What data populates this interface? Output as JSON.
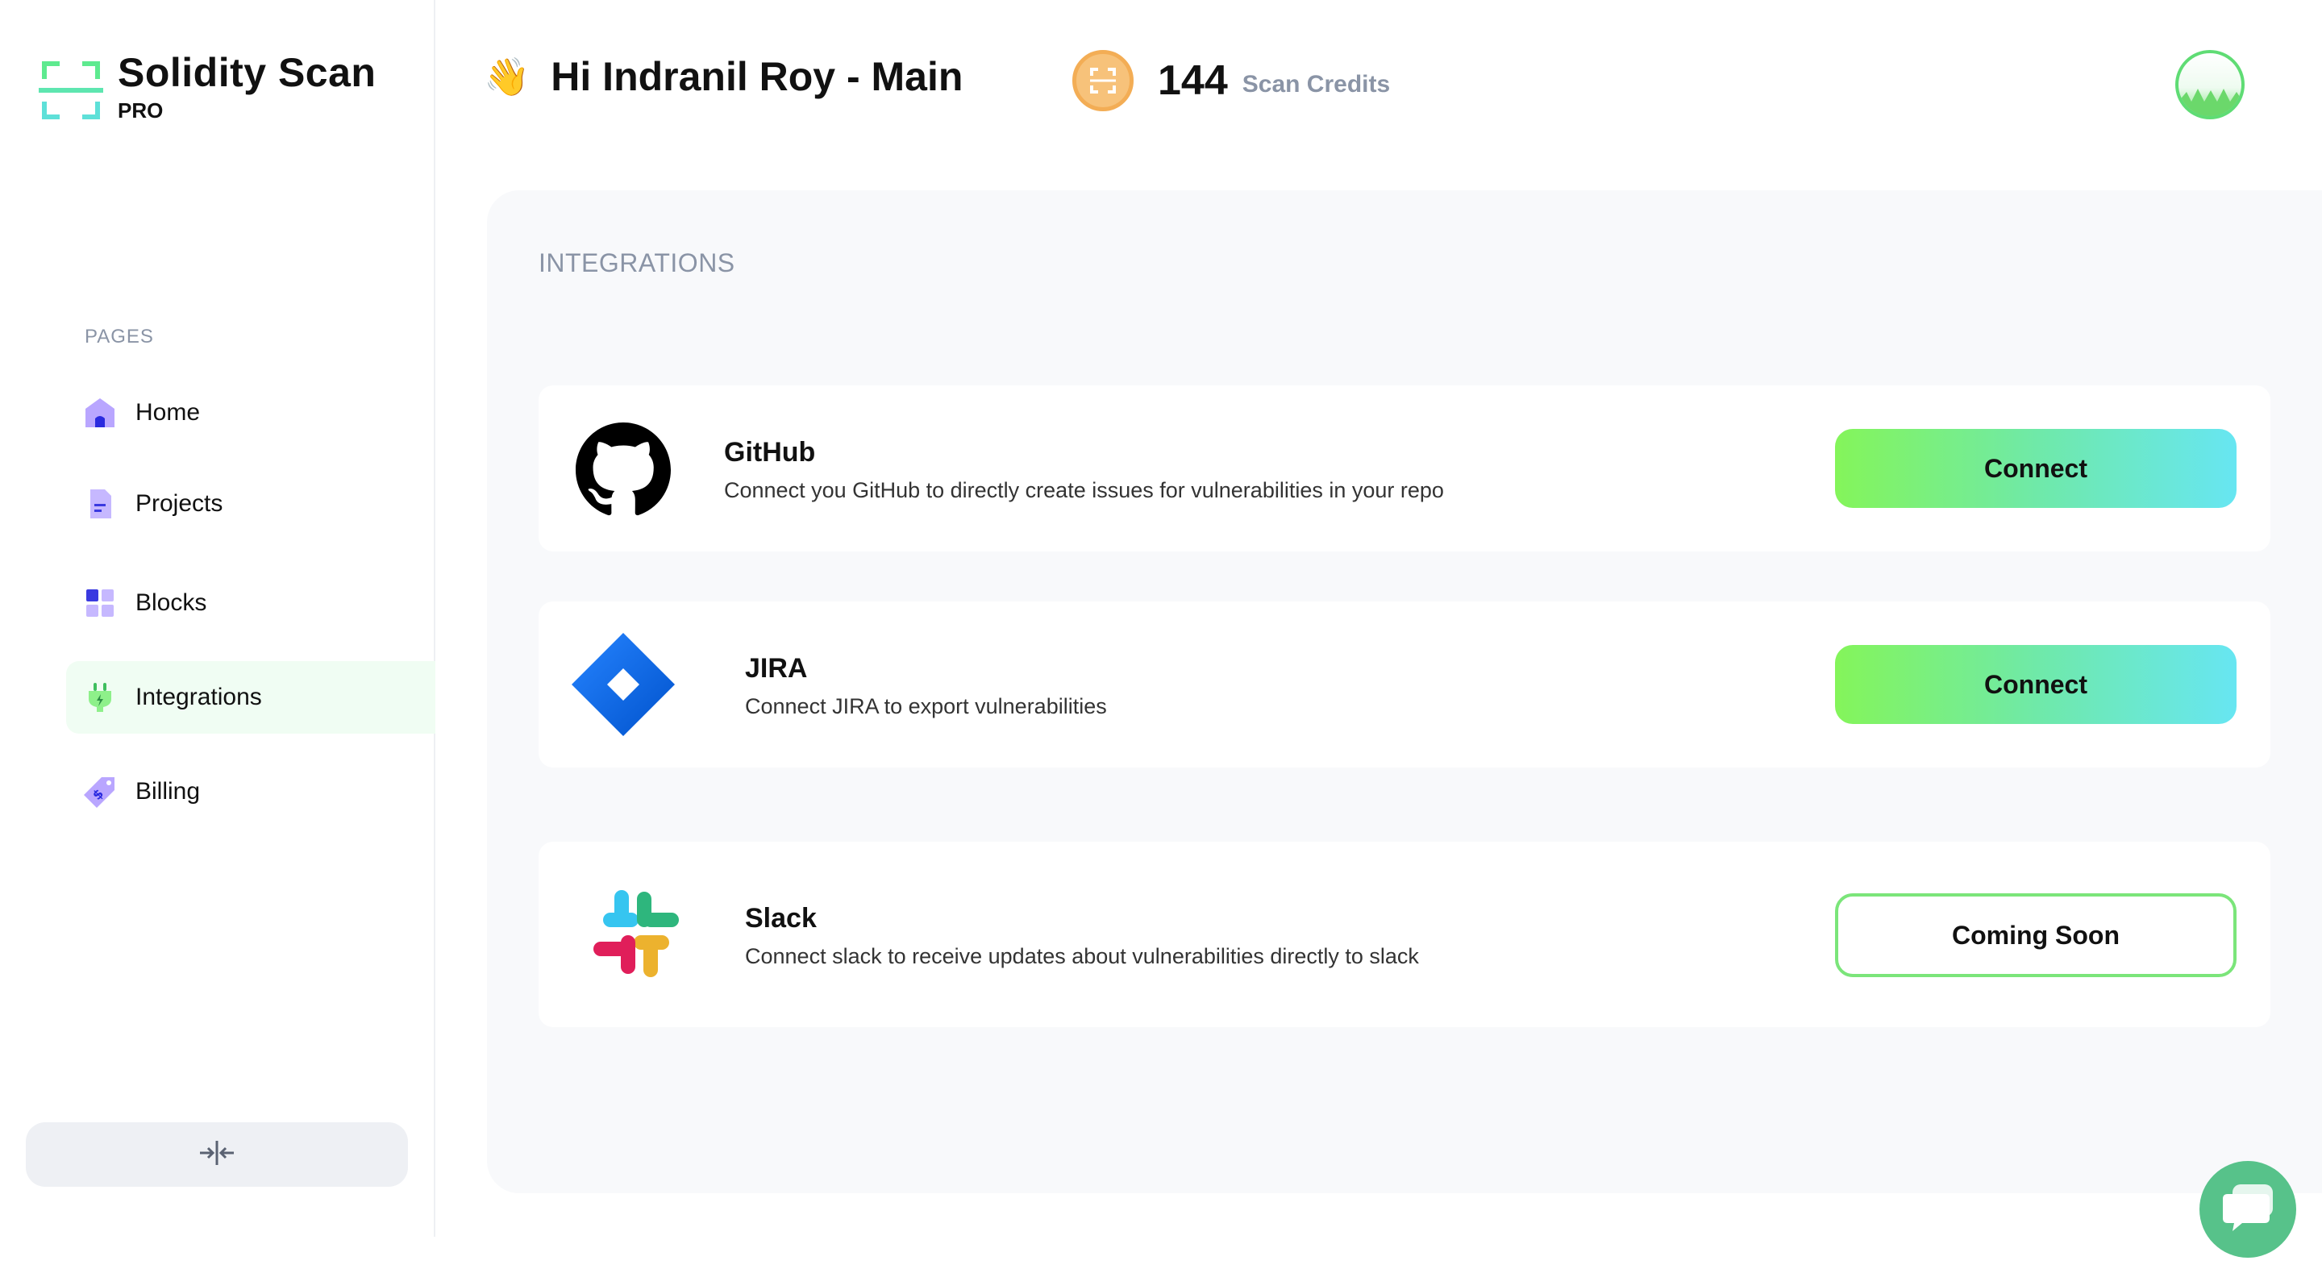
{
  "brand": {
    "name": "Solidity Scan",
    "tier": "PRO"
  },
  "sidebar": {
    "section_label": "PAGES",
    "items": [
      {
        "label": "Home",
        "icon": "home-icon"
      },
      {
        "label": "Projects",
        "icon": "document-icon"
      },
      {
        "label": "Blocks",
        "icon": "blocks-icon"
      },
      {
        "label": "Integrations",
        "icon": "plug-icon",
        "active": true
      },
      {
        "label": "Billing",
        "icon": "price-tag-icon"
      }
    ],
    "collapse_icon": "collapse-icon"
  },
  "header": {
    "greeting": "Hi Indranil Roy - Main",
    "wave_emoji": "👋",
    "credits_count": "144",
    "credits_label": "Scan Credits"
  },
  "main": {
    "title": "INTEGRATIONS",
    "integrations": [
      {
        "name": "GitHub",
        "description": "Connect you GitHub to directly create issues for vulnerabilities in your repo",
        "action": "Connect"
      },
      {
        "name": "JIRA",
        "description": "Connect JIRA to export vulnerabilities",
        "action": "Connect"
      },
      {
        "name": "Slack",
        "description": "Connect slack to receive updates about vulnerabilities directly to slack",
        "action": "Coming Soon"
      }
    ]
  },
  "colors": {
    "accent_green": "#84f55a",
    "accent_cyan": "#67e6f2",
    "muted_text": "#8a94a6",
    "active_nav_bg": "#f0fdf3",
    "chat_bubble": "#57c28a"
  }
}
